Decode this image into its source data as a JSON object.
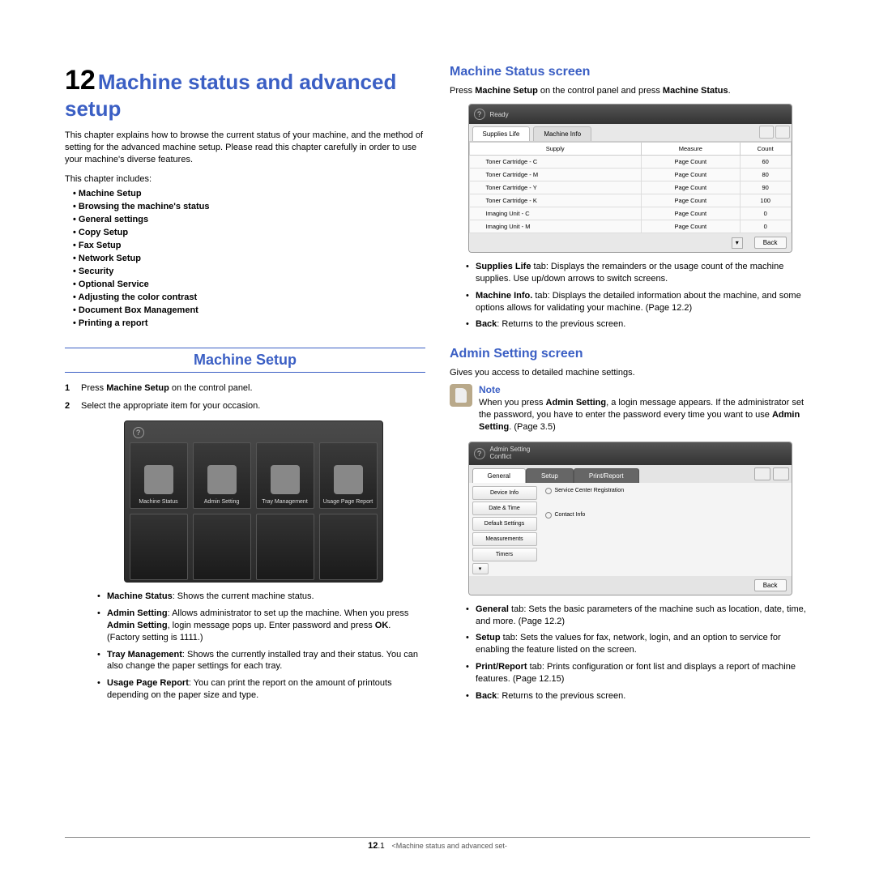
{
  "chapter": {
    "number": "12",
    "title": "Machine status and advanced setup"
  },
  "intro": "This chapter explains how to browse the current status of your machine, and the method of setting for the advanced machine setup. Please read this chapter carefully in order to use your machine's diverse features.",
  "includes_label": "This chapter includes:",
  "toc": [
    "Machine Setup",
    "Browsing the machine's status",
    "General settings",
    "Copy Setup",
    "Fax Setup",
    "Network Setup",
    "Security",
    "Optional Service",
    "Adjusting the color contrast",
    "Document Box Management",
    "Printing a report"
  ],
  "section_machine_setup": {
    "heading": "Machine Setup",
    "step1_a": "Press ",
    "step1_b": "Machine Setup",
    "step1_c": " on the control panel.",
    "step2": "Select the appropriate item for your occasion.",
    "tiles": [
      "Machine Status",
      "Admin Setting",
      "Tray Management",
      "Usage Page Report"
    ],
    "b1_b": "Machine Status",
    "b1_t": ": Shows the current machine status.",
    "b2_b": "Admin Setting",
    "b2_t1": ": Allows administrator to set up the machine. When you press ",
    "b2_t2": ", login message pops up. Enter password and press ",
    "b2_ok": "OK",
    "b2_t3": ". (Factory setting is 1111.)",
    "b3_b": "Tray Management",
    "b3_t": ": Shows the currently installed tray and their status. You can also change the paper settings for each tray.",
    "b4_b": "Usage Page Report",
    "b4_t": ": You can print the report on the amount of printouts depending on the paper size and type."
  },
  "section_status": {
    "heading": "Machine Status screen",
    "lead_a": "Press ",
    "lead_b": "Machine Setup",
    "lead_c": " on the control panel and press ",
    "lead_d": "Machine Status",
    "lead_e": ".",
    "ss": {
      "ready": "Ready",
      "tab1": "Supplies Life",
      "tab2": "Machine Info",
      "h1": "Supply",
      "h2": "Measure",
      "h3": "Count",
      "rows": [
        {
          "s": "Toner Cartridge - C",
          "m": "Page Count",
          "c": "60"
        },
        {
          "s": "Toner Cartridge - M",
          "m": "Page Count",
          "c": "80"
        },
        {
          "s": "Toner Cartridge - Y",
          "m": "Page Count",
          "c": "90"
        },
        {
          "s": "Toner Cartridge - K",
          "m": "Page Count",
          "c": "100"
        },
        {
          "s": "Imaging Unit - C",
          "m": "Page Count",
          "c": "0"
        },
        {
          "s": "Imaging Unit - M",
          "m": "Page Count",
          "c": "0"
        }
      ],
      "back": "Back"
    },
    "b1_b": "Supplies Life",
    "b1_t": " tab: Displays the remainders or the usage count of the machine supplies. Use up/down arrows to switch screens.",
    "b2_b": "Machine Info.",
    "b2_t": " tab: Displays the detailed information about the machine, and some options allows for validating your machine. (Page 12.2)",
    "b3_b": "Back",
    "b3_t": ": Returns to the previous screen."
  },
  "section_admin": {
    "heading": "Admin Setting screen",
    "lead": "Gives you access to detailed machine settings.",
    "note_title": "Note",
    "note_a": "When you press ",
    "note_b": "Admin Setting",
    "note_c": ", a login message appears. If the administrator set the password, you have to enter the password every time you want to use ",
    "note_d": "Admin Setting",
    "note_e": ". (Page 3.5)",
    "ss": {
      "title1": "Admin Setting",
      "title2": "Conflict",
      "tabs": [
        "General",
        "Setup",
        "Print/Report"
      ],
      "side": [
        "Device Info",
        "Date & Time",
        "Default Settings",
        "Measurements",
        "Timers"
      ],
      "opt1": "Service Center Registration",
      "opt2": "Contact Info",
      "back": "Back"
    },
    "b1_b": "General",
    "b1_t": " tab: Sets the basic parameters of the machine such as location, date, time, and more. (Page 12.2)",
    "b2_b": "Setup",
    "b2_t": " tab: Sets the values for fax, network, login, and an option to service for enabling the feature listed on the screen.",
    "b3_b": "Print/Report",
    "b3_t": " tab: Prints configuration or font list and displays a report of machine features. (Page 12.15)",
    "b4_b": "Back",
    "b4_t": ": Returns to the previous screen."
  },
  "footer": {
    "page": "12",
    "sub": ".1",
    "breadcrumb": "<Machine status and advanced set-"
  }
}
